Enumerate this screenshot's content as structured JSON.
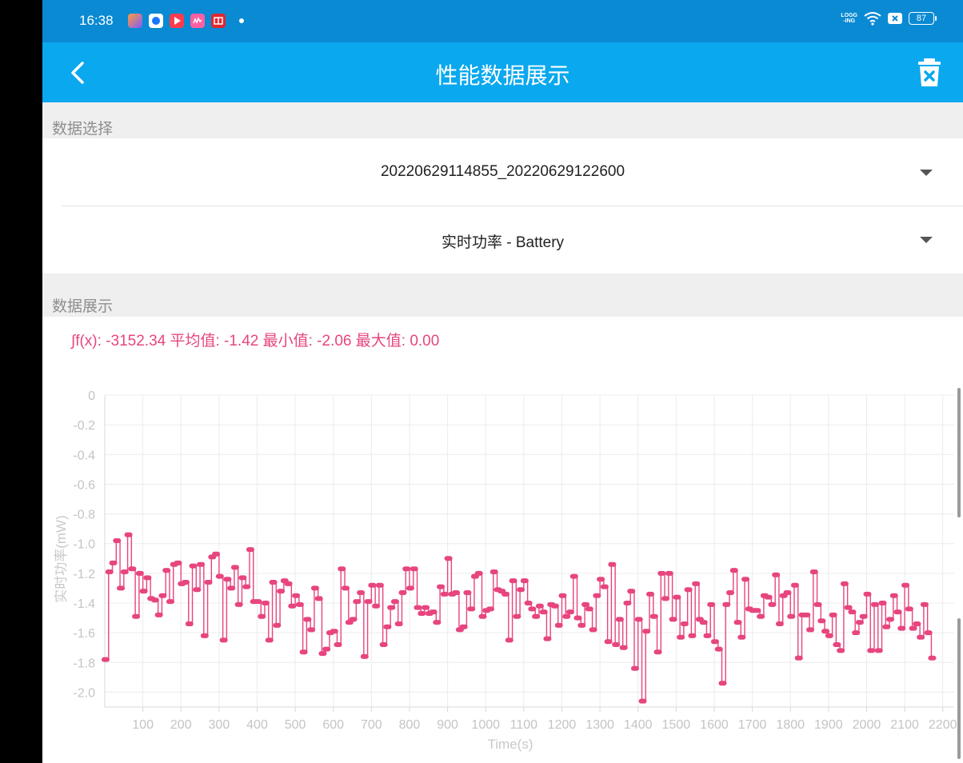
{
  "status_bar": {
    "time": "16:38",
    "network_label_top": "LOGG",
    "network_label_bottom": "-ING",
    "battery_level": "87",
    "notification_icons": [
      "app-icon-1",
      "app-icon-2",
      "video-icon",
      "music-icon",
      "news-icon"
    ]
  },
  "header": {
    "title": "性能数据展示",
    "back_icon": "chevron-left-icon",
    "delete_icon": "trash-x-icon"
  },
  "data_select": {
    "section_label": "数据选择",
    "file_value": "20220629114855_20220629122600",
    "metric_value": "实时功率 - Battery"
  },
  "data_display": {
    "section_label": "数据展示",
    "stats_text": "∫f(x): -3152.34 平均值: -1.42 最小值: -2.06 最大值: 0.00"
  },
  "colors": {
    "accent": "#0aa8ee",
    "status_bar": "#0a8ad3",
    "series": "#e7457f"
  },
  "chart_data": {
    "type": "line",
    "title": "",
    "xlabel": "Time(s)",
    "ylabel": "实时功率(mW)",
    "xlim": [
      0,
      2230
    ],
    "ylim": [
      -2.1,
      0
    ],
    "x_ticks": [
      100,
      200,
      300,
      400,
      500,
      600,
      700,
      800,
      900,
      1000,
      1100,
      1200,
      1300,
      1400,
      1500,
      1600,
      1700,
      1800,
      1900,
      2000,
      2100,
      2200
    ],
    "y_ticks": [
      {
        "v": 0,
        "label": "0"
      },
      {
        "v": -0.2,
        "label": "-0.2"
      },
      {
        "v": -0.4,
        "label": "-0.4"
      },
      {
        "v": -0.6,
        "label": "-0.6"
      },
      {
        "v": -0.8,
        "label": "-0.8"
      },
      {
        "v": -1.0,
        "label": "-1.0"
      },
      {
        "v": -1.2,
        "label": "-1.2"
      },
      {
        "v": -1.4,
        "label": "-1.4"
      },
      {
        "v": -1.6,
        "label": "-1.6"
      },
      {
        "v": -1.8,
        "label": "-1.8"
      },
      {
        "v": -2.0,
        "label": "-2.0"
      }
    ],
    "grid": true,
    "legend": "none",
    "series": [
      {
        "step": 10,
        "values": [
          -1.78,
          -1.19,
          -1.13,
          -0.98,
          -1.3,
          -1.19,
          -0.94,
          -1.17,
          -1.49,
          -1.2,
          -1.32,
          -1.23,
          -1.37,
          -1.38,
          -1.48,
          -1.35,
          -1.18,
          -1.39,
          -1.14,
          -1.13,
          -1.27,
          -1.26,
          -1.54,
          -1.15,
          -1.31,
          -1.14,
          -1.62,
          -1.26,
          -1.09,
          -1.07,
          -1.22,
          -1.65,
          -1.24,
          -1.3,
          -1.16,
          -1.41,
          -1.23,
          -1.29,
          -1.04,
          -1.39,
          -1.39,
          -1.49,
          -1.4,
          -1.65,
          -1.26,
          -1.55,
          -1.32,
          -1.25,
          -1.27,
          -1.42,
          -1.35,
          -1.41,
          -1.73,
          -1.51,
          -1.58,
          -1.3,
          -1.37,
          -1.74,
          -1.71,
          -1.6,
          -1.59,
          -1.68,
          -1.17,
          -1.3,
          -1.53,
          -1.51,
          -1.39,
          -1.33,
          -1.76,
          -1.39,
          -1.28,
          -1.42,
          -1.28,
          -1.68,
          -1.56,
          -1.43,
          -1.39,
          -1.54,
          -1.33,
          -1.17,
          -1.3,
          -1.17,
          -1.43,
          -1.47,
          -1.43,
          -1.47,
          -1.46,
          -1.53,
          -1.29,
          -1.34,
          -1.1,
          -1.34,
          -1.33,
          -1.58,
          -1.56,
          -1.33,
          -1.44,
          -1.22,
          -1.2,
          -1.49,
          -1.45,
          -1.44,
          -1.19,
          -1.31,
          -1.32,
          -1.34,
          -1.65,
          -1.25,
          -1.49,
          -1.31,
          -1.25,
          -1.4,
          -1.44,
          -1.49,
          -1.42,
          -1.46,
          -1.64,
          -1.41,
          -1.42,
          -1.55,
          -1.35,
          -1.49,
          -1.46,
          -1.22,
          -1.5,
          -1.55,
          -1.41,
          -1.44,
          -1.58,
          -1.35,
          -1.24,
          -1.29,
          -1.66,
          -1.14,
          -1.68,
          -1.51,
          -1.7,
          -1.4,
          -1.32,
          -1.84,
          -1.51,
          -2.06,
          -1.59,
          -1.34,
          -1.49,
          -1.73,
          -1.2,
          -1.37,
          -1.2,
          -1.51,
          -1.36,
          -1.63,
          -1.54,
          -1.31,
          -1.62,
          -1.27,
          -1.51,
          -1.53,
          -1.62,
          -1.41,
          -1.66,
          -1.71,
          -1.94,
          -1.41,
          -1.33,
          -1.18,
          -1.53,
          -1.63,
          -1.24,
          -1.44,
          -1.45,
          -1.45,
          -1.49,
          -1.35,
          -1.36,
          -1.41,
          -1.21,
          -1.54,
          -1.35,
          -1.33,
          -1.49,
          -1.28,
          -1.77,
          -1.48,
          -1.48,
          -1.58,
          -1.19,
          -1.41,
          -1.52,
          -1.59,
          -1.62,
          -1.48,
          -1.68,
          -1.72,
          -1.27,
          -1.43,
          -1.46,
          -1.6,
          -1.53,
          -1.49,
          -1.34,
          -1.72,
          -1.41,
          -1.72,
          -1.4,
          -1.56,
          -1.51,
          -1.35,
          -1.46,
          -1.57,
          -1.28,
          -1.44,
          -1.57,
          -1.54,
          -1.63,
          -1.41,
          -1.6,
          -1.77
        ]
      }
    ]
  }
}
